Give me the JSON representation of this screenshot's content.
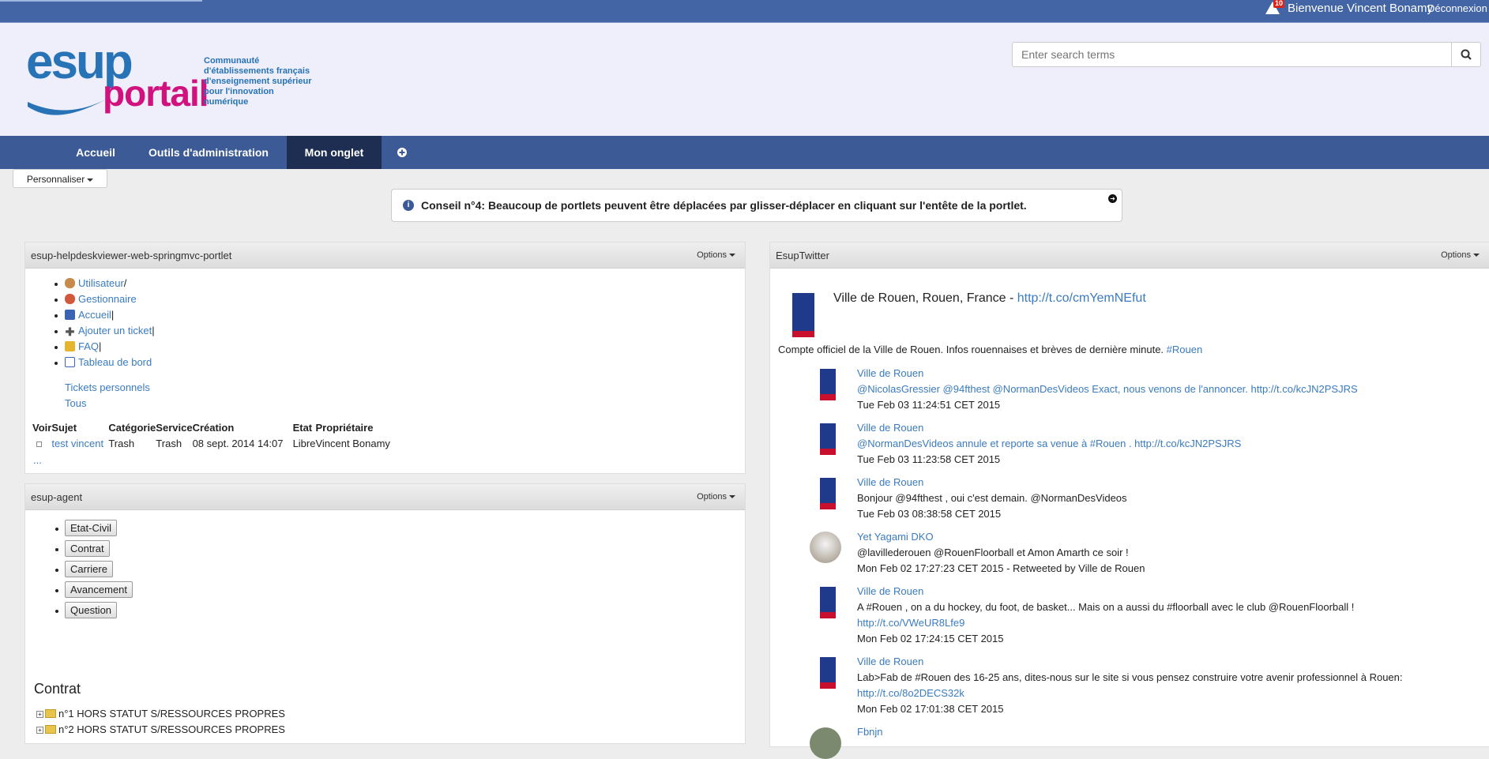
{
  "topbar": {
    "alert_count": "10",
    "welcome": "Bienvenue Vincent Bonamy",
    "logout": "Déconnexion"
  },
  "logo": {
    "esup": "esup",
    "portail": "portail",
    "tagline_1": "Communauté",
    "tagline_2": "d'établissements français",
    "tagline_3": "d'enseignement supérieur",
    "tagline_4": "pour l'innovation",
    "tagline_5": "numérique"
  },
  "search": {
    "placeholder": "Enter search terms"
  },
  "nav": {
    "tabs": [
      "Accueil",
      "Outils d'administration",
      "Mon onglet"
    ],
    "active": "Mon onglet"
  },
  "customize": {
    "label": "Personnaliser"
  },
  "tip": {
    "text": "Conseil n°4: Beaucoup de portlets peuvent être déplacées par glisser-déplacer en cliquant sur l'entête de la portlet."
  },
  "helpdesk": {
    "title": "esup-helpdeskviewer-web-springmvc-portlet",
    "options": "Options",
    "menu": [
      {
        "label": "Utilisateur",
        "suffix": "/"
      },
      {
        "label": "Gestionnaire",
        "suffix": ""
      },
      {
        "label": "Accueil",
        "suffix": "|"
      },
      {
        "label": "Ajouter un ticket",
        "suffix": "|"
      },
      {
        "label": "FAQ",
        "suffix": "|"
      },
      {
        "label": "Tableau de bord",
        "suffix": ""
      }
    ],
    "filters": [
      "Tickets personnels",
      "Tous"
    ],
    "columns": [
      "Voir",
      "Sujet",
      "Catégorie",
      "Service",
      "Création",
      "Etat",
      "Propriétaire"
    ],
    "rows": [
      {
        "sujet": "test vincent",
        "categorie": "Trash",
        "service": "Trash",
        "creation": "08 sept. 2014 14:07",
        "etat": "Libre",
        "proprietaire": "Vincent Bonamy"
      }
    ],
    "more": "..."
  },
  "agent": {
    "title": "esup-agent",
    "options": "Options",
    "buttons": [
      "Etat-Civil",
      "Contrat",
      "Carriere",
      "Avancement",
      "Question"
    ],
    "section_title": "Contrat",
    "tree": [
      "n°1 HORS STATUT S/RESSOURCES PROPRES",
      "n°2 HORS STATUT S/RESSOURCES PROPRES"
    ]
  },
  "twitter": {
    "title": "EsupTwitter",
    "options": "Options",
    "profile_name": "Ville de Rouen, Rouen, France - ",
    "profile_link": "http://t.co/cmYemNEfut",
    "profile_desc": "Compte officiel de la Ville de Rouen. Infos rouennaises et brèves de dernière minute. ",
    "profile_tag": "#Rouen",
    "tweets": [
      {
        "author": "Ville de Rouen",
        "line1": "@NicolasGressier @94fthest @NormanDesVideos Exact, nous venons de l'annoncer. http://t.co/kcJN2PSJRS",
        "line2": "",
        "date": "Tue Feb 03 11:24:51 CET 2015"
      },
      {
        "author": "Ville de Rouen",
        "line1": "@NormanDesVideos annule et reporte sa venue à #Rouen . http://t.co/kcJN2PSJRS",
        "line2": "",
        "date": "Tue Feb 03 11:23:58 CET 2015"
      },
      {
        "author": "Ville de Rouen",
        "line1": "Bonjour @94fthest , oui c'est demain. @NormanDesVideos",
        "line2": "",
        "date": "Tue Feb 03 08:38:58 CET 2015"
      },
      {
        "author": "Yet Yagami DKO",
        "line1": "@lavillederouen @RouenFloorball et Amon Amarth ce soir !",
        "line2": "",
        "date": "Mon Feb 02 17:27:23 CET 2015 - Retweeted by Ville de Rouen"
      },
      {
        "author": "Ville de Rouen",
        "line1": "A #Rouen , on a du hockey, du foot, de basket... Mais on a aussi du #floorball avec le club @RouenFloorball !",
        "line2": "http://t.co/VWeUR8Lfe9",
        "date": "Mon Feb 02 17:24:15 CET 2015"
      },
      {
        "author": "Ville de Rouen",
        "line1": "Lab>Fab de #Rouen des 16-25 ans, dites-nous sur le site si vous pensez construire votre avenir professionnel à Rouen:",
        "line2": "http://t.co/8o2DECS32k",
        "date": "Mon Feb 02 17:01:38 CET 2015"
      },
      {
        "author": "Fbnjn",
        "line1": "",
        "line2": "",
        "date": ""
      }
    ]
  },
  "colors": {
    "topbar": "#4465a5",
    "nav": "#3b5a96",
    "nav_active": "#1d2e52",
    "link": "#3a7bbf",
    "brand_blue": "#2773b6",
    "brand_pink": "#d1127e"
  }
}
